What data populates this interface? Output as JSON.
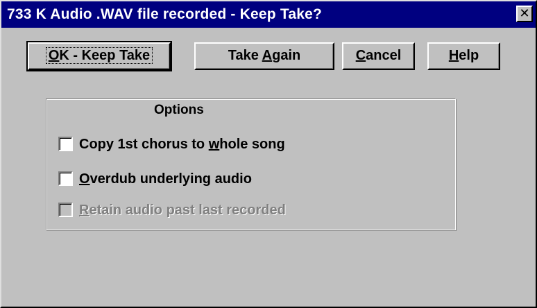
{
  "window": {
    "title": "733 K Audio .WAV file recorded - Keep Take?",
    "close_glyph": "✕"
  },
  "buttons": {
    "ok": {
      "underline": "O",
      "rest": "K - Keep Take"
    },
    "take_again": {
      "pre": "Take ",
      "underline": "A",
      "rest": "gain"
    },
    "cancel": {
      "underline": "C",
      "rest": "ancel"
    },
    "help": {
      "underline": "H",
      "rest": "elp"
    }
  },
  "options": {
    "title": "Options",
    "items": [
      {
        "pre": "Copy 1st chorus to ",
        "underline": "w",
        "rest": "hole song",
        "checked": false,
        "enabled": true
      },
      {
        "pre": "",
        "underline": "O",
        "rest": "verdub underlying audio",
        "checked": false,
        "enabled": true
      },
      {
        "pre": "",
        "underline": "R",
        "rest": "etain audio past last recorded",
        "checked": false,
        "enabled": false
      }
    ]
  },
  "colors": {
    "titlebar": "#000080",
    "face": "#c0c0c0",
    "disabled_text": "#808080"
  }
}
